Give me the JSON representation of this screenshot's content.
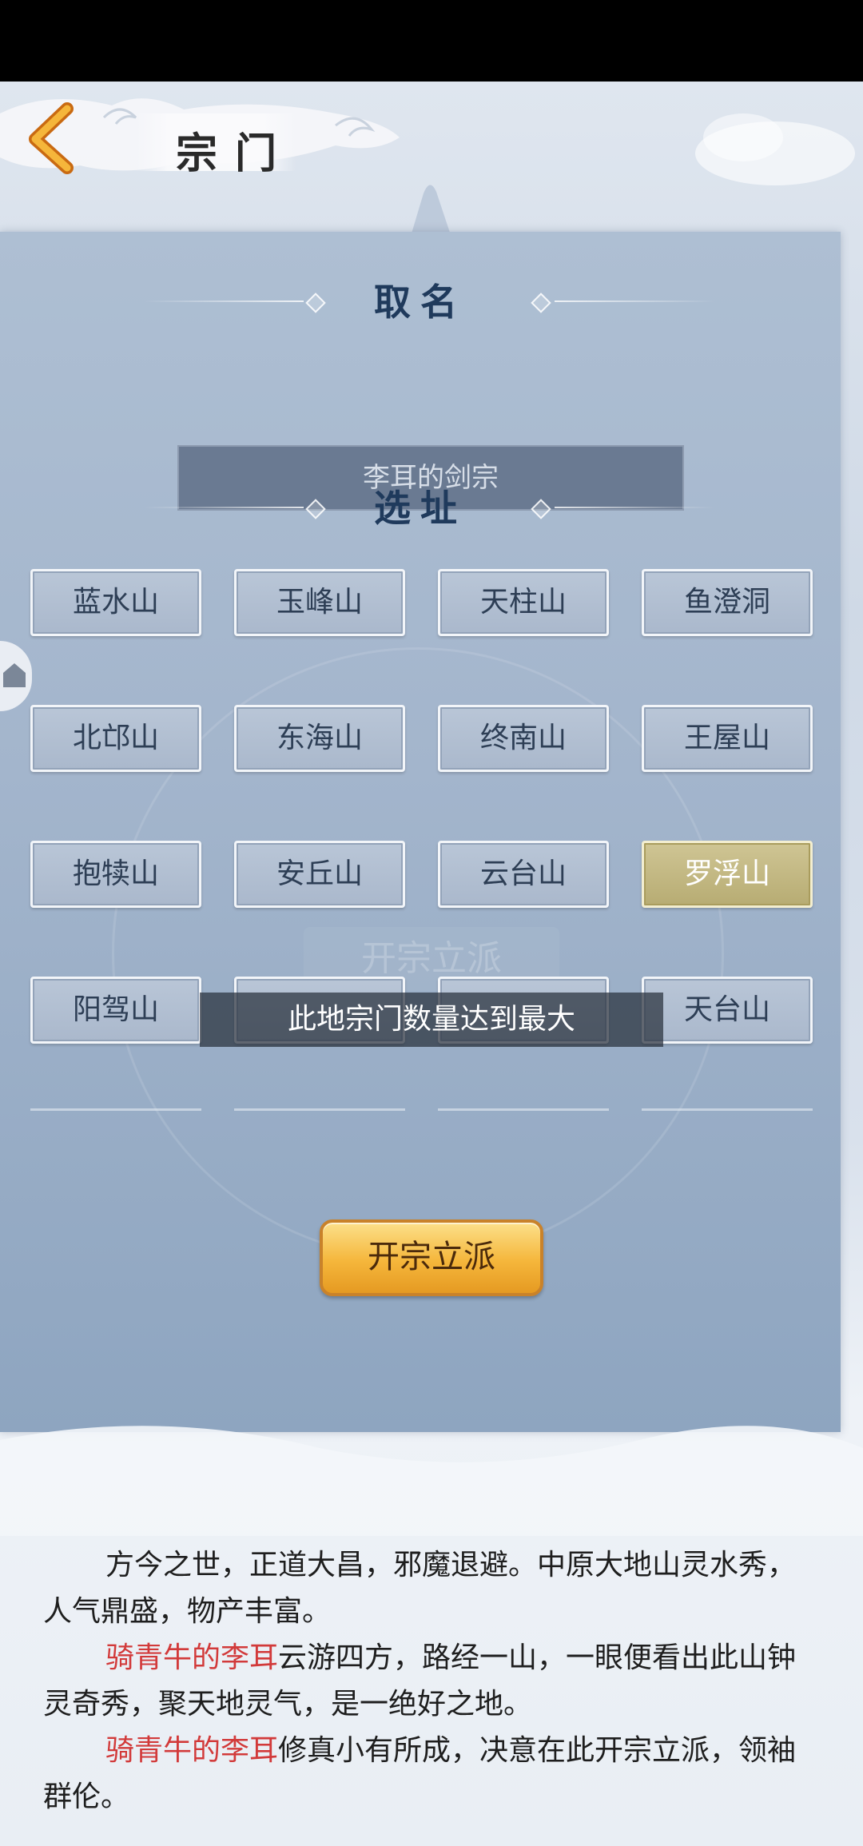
{
  "header": {
    "title": "宗门"
  },
  "naming": {
    "heading": "取名",
    "sect_name": "李耳的剑宗"
  },
  "site": {
    "heading": "选址",
    "locations": [
      {
        "label": "蓝水山",
        "selected": false
      },
      {
        "label": "玉峰山",
        "selected": false
      },
      {
        "label": "天柱山",
        "selected": false
      },
      {
        "label": "鱼澄洞",
        "selected": false
      },
      {
        "label": "北邙山",
        "selected": false
      },
      {
        "label": "东海山",
        "selected": false
      },
      {
        "label": "终南山",
        "selected": false
      },
      {
        "label": "王屋山",
        "selected": false
      },
      {
        "label": "抱犊山",
        "selected": false
      },
      {
        "label": "安丘山",
        "selected": false
      },
      {
        "label": "云台山",
        "selected": false
      },
      {
        "label": "罗浮山",
        "selected": true
      },
      {
        "label": "阳驾山",
        "selected": false
      },
      {
        "label": "",
        "selected": false
      },
      {
        "label": "",
        "selected": false
      },
      {
        "label": "天台山",
        "selected": false
      }
    ]
  },
  "toast": "此地宗门数量达到最大",
  "watermark": "开宗立派",
  "found_button": "开宗立派",
  "story": {
    "p1": "方今之世，正道大昌，邪魔退避。中原大地山灵水秀，人气鼎盛，物产丰富。",
    "p2_name": "骑青牛的李耳",
    "p2_text": "云游四方，路经一山，一眼便看出此山钟灵奇秀，聚天地灵气，是一绝好之地。",
    "p3_name": "骑青牛的李耳",
    "p3_text": "修真小有所成，决意在此开宗立派，领袖群伦。"
  },
  "colors": {
    "accent_gold": "#f5b63b",
    "selected_site": "#cfc594",
    "highlight_red": "#d23a3a"
  }
}
